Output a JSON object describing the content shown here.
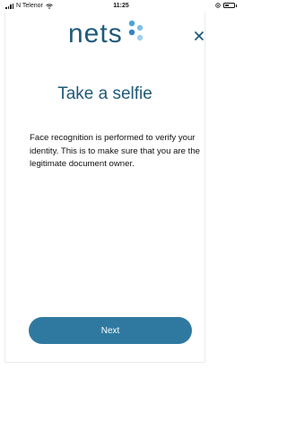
{
  "status_bar": {
    "carrier": "N Telenor",
    "time": "11:25",
    "battery_level": 0.4
  },
  "header": {
    "logo_text": "nets",
    "close_icon": "close-icon"
  },
  "main": {
    "title": "Take a selfie",
    "description": "Face recognition is performed to verify your identity. This is to make sure that you are the legitimate document owner.",
    "next_label": "Next"
  },
  "colors": {
    "brand": "#1f5a7a",
    "button": "#2f79a0",
    "logo_dots": "#4aa3d8"
  }
}
